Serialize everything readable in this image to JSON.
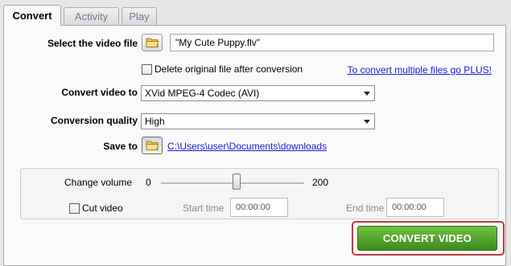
{
  "tabs": [
    {
      "label": "Convert",
      "active": true
    },
    {
      "label": "Activity",
      "active": false
    },
    {
      "label": "Play",
      "active": false
    }
  ],
  "video_file": {
    "label": "Select the video file",
    "value": "\"My Cute Puppy.flv\"",
    "button_icon": "folder-icon"
  },
  "delete_original": {
    "label": "Delete original file after conversion",
    "checked": false
  },
  "plus_link": "To convert multiple files go PLUS!",
  "convert_to": {
    "label": "Convert video to",
    "selected": "XVid MPEG-4 Codec (AVI)"
  },
  "quality": {
    "label": "Conversion quality",
    "selected": "High"
  },
  "save_to": {
    "label": "Save to",
    "path": "C:\\Users\\user\\Documents\\downloads",
    "button_icon": "folder-icon"
  },
  "volume": {
    "label": "Change volume",
    "min": "0",
    "max": "200",
    "level": 100
  },
  "cut_video": {
    "label": "Cut video",
    "checked": false
  },
  "start_time": {
    "label": "Start time",
    "value": "00:00:00"
  },
  "end_time": {
    "label": "End time",
    "value": "00:00:00"
  },
  "convert_button": "CONVERT VIDEO",
  "colors": {
    "accent_green": "#4a9e26",
    "highlight_red": "#c33a3a",
    "link_blue": "#1a1ad6"
  }
}
